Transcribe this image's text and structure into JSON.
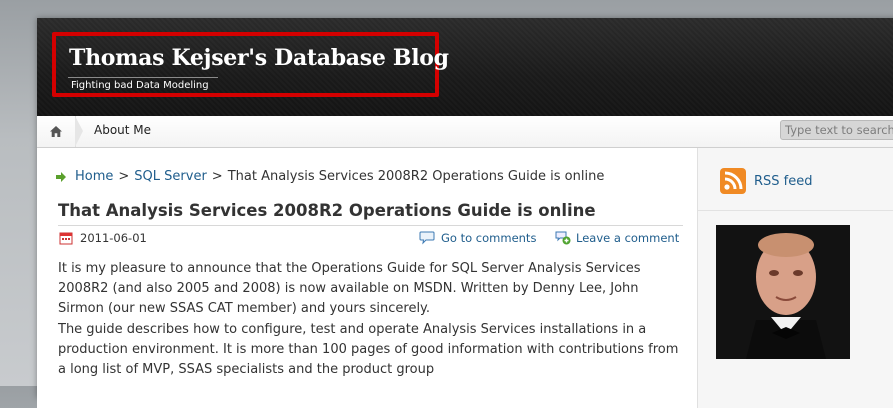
{
  "header": {
    "blog_title": "Thomas Kejser's Database Blog",
    "tagline": "Fighting bad Data Modeling"
  },
  "nav": {
    "home_icon": "home-icon",
    "items": [
      {
        "label": "About Me"
      }
    ],
    "search_placeholder": "Type text to search"
  },
  "breadcrumb": {
    "home": "Home",
    "sep": ">",
    "category": "SQL Server",
    "current": "That Analysis Services 2008R2 Operations Guide is online"
  },
  "post": {
    "title": "That Analysis Services 2008R2 Operations Guide is online",
    "date": "2011-06-01",
    "comments_link": "Go to comments",
    "leave_comment_link": "Leave a comment",
    "paragraphs": [
      "It is my pleasure to announce that the Operations Guide for SQL Server Analysis Services 2008R2 (and also 2005 and 2008) is now available on MSDN. Written by Denny Lee, John Sirmon (our new SSAS CAT member) and yours sincerely.",
      "The guide describes how to configure, test and operate Analysis Services installations in a production environment. It is more than 100 pages of good information with contributions from a long list of MVP, SSAS specialists and the product group"
    ]
  },
  "sidebar": {
    "rss_label": "RSS feed"
  },
  "colors": {
    "link": "#1f5d8c",
    "highlight_border": "#d40000",
    "header_bg": "#1a1a1a",
    "rss_orange": "#f08a24"
  }
}
